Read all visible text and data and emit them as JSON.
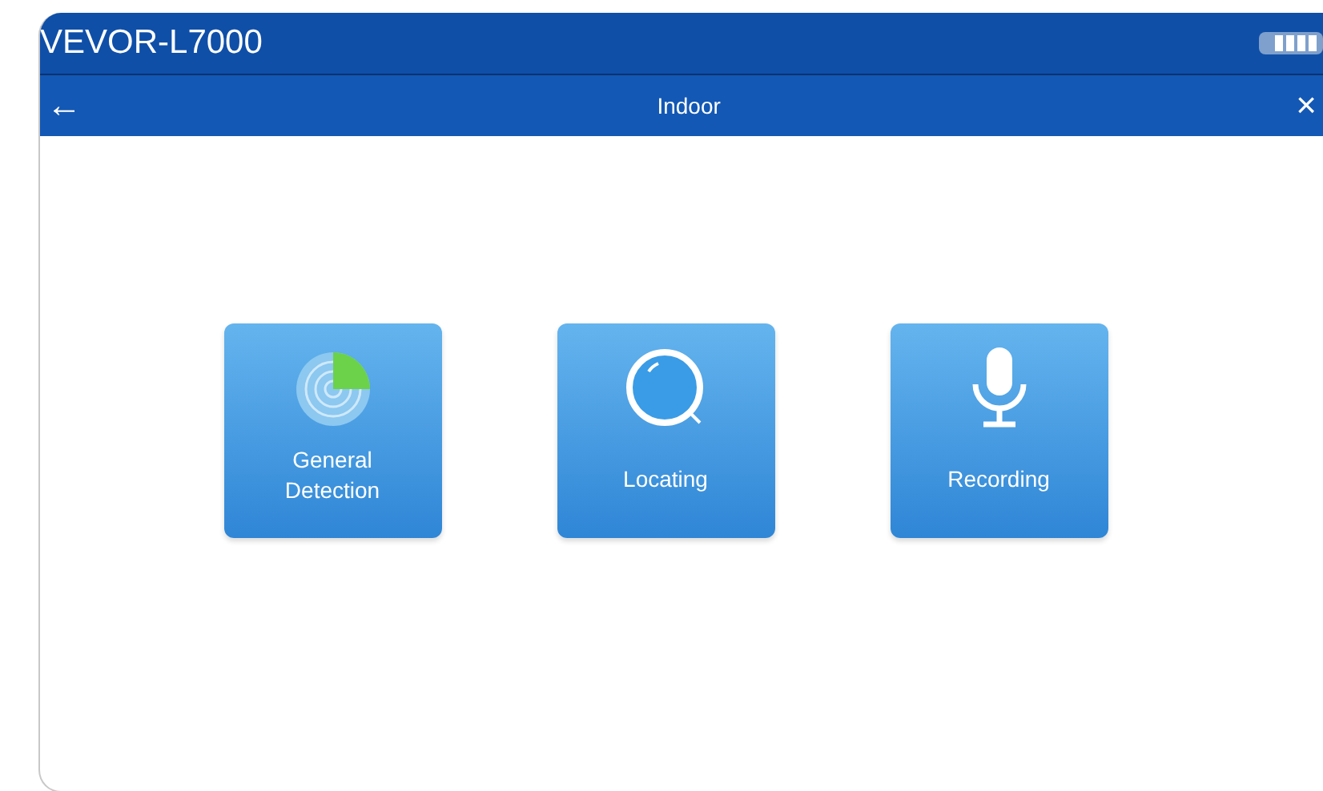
{
  "device": {
    "title": "VEVOR-L7000"
  },
  "nav": {
    "back": "←",
    "title": "Indoor",
    "close": "×"
  },
  "modes": [
    {
      "kind": "radar",
      "label": "General Detection"
    },
    {
      "kind": "lens",
      "label": "Locating"
    },
    {
      "kind": "mic",
      "label": "Recording"
    }
  ]
}
